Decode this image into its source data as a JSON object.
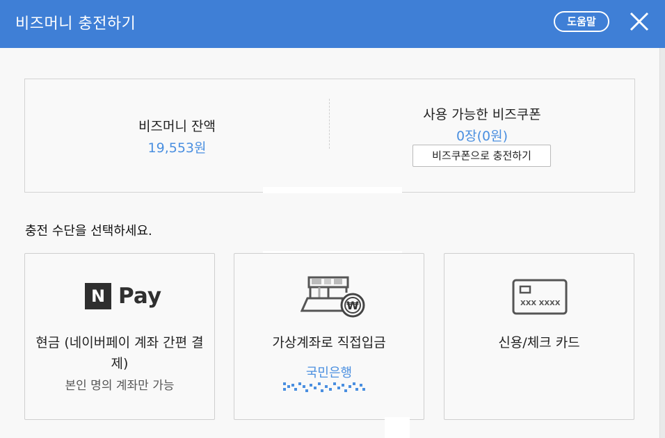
{
  "header": {
    "title": "비즈머니 충전하기",
    "help_label": "도움말",
    "bg_color": "#3f7fd6"
  },
  "balance": {
    "label": "비즈머니 잔액",
    "value": "19,553원"
  },
  "coupon": {
    "label": "사용 가능한 비즈쿠폰",
    "value": "0장(0원)",
    "button_label": "비즈쿠폰으로 충전하기"
  },
  "section": {
    "title": "충전 수단을 선택하세요."
  },
  "methods": [
    {
      "logo_text": "Pay",
      "logo_badge": "N",
      "title": "현금 (네이버페이 계좌 간편 결제)",
      "subtitle": "본인 명의 계좌만 가능",
      "icon": "naverpay-logo"
    },
    {
      "title": "가상계좌로 직접입금",
      "bank": "국민은행",
      "icon": "virtual-account-won-icon"
    },
    {
      "title": "신용/체크 카드",
      "card_text": "XXX XXXX",
      "icon": "credit-card-icon"
    }
  ],
  "colors": {
    "accent": "#4a8fe0",
    "header": "#3f7fd6"
  }
}
